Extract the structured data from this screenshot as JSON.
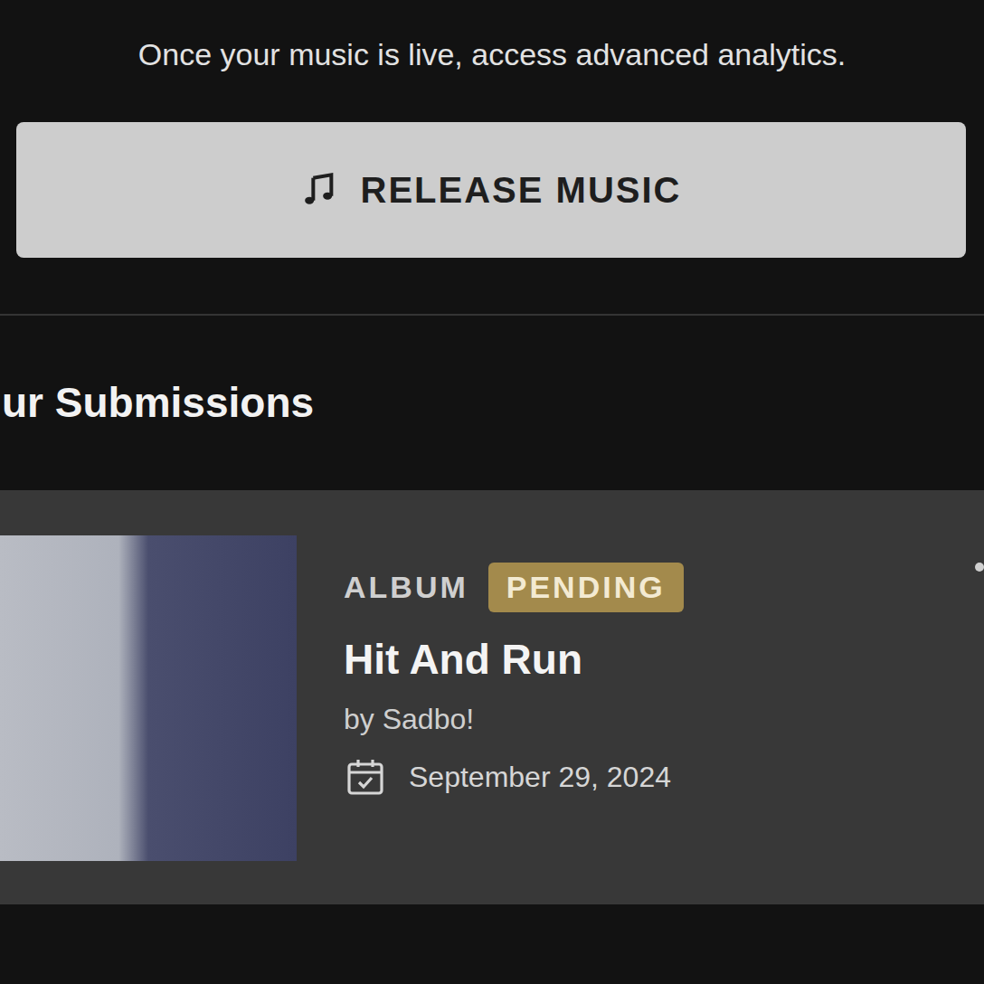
{
  "notice": "Once your music is live, access advanced analytics.",
  "release_button": {
    "label": "RELEASE MUSIC"
  },
  "section": {
    "title": "ur Submissions"
  },
  "submissions": [
    {
      "type": "ALBUM",
      "status": "PENDING",
      "title": "Hit And Run",
      "artist": "by Sadbo!",
      "date": "September 29, 2024"
    }
  ]
}
